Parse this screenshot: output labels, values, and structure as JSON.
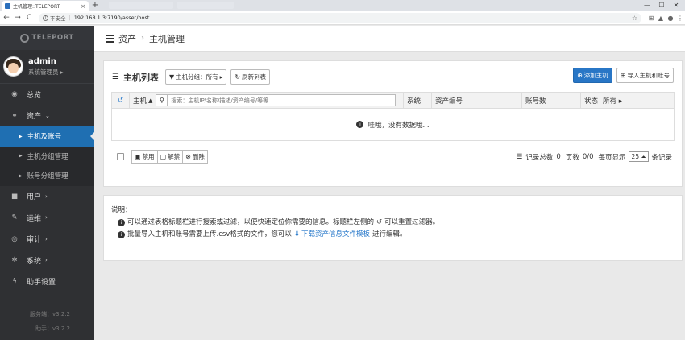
{
  "browser": {
    "tab_title": "主机管理::TELEPORT",
    "tab_close": "×",
    "new_tab": "+",
    "win_min": "—",
    "win_max": "☐",
    "win_close": "✕",
    "back": "←",
    "forward": "→",
    "reload": "C",
    "security": "不安全",
    "url": "192.168.1.3:7190/asset/host"
  },
  "sidebar": {
    "logo": "TELEPORT",
    "user": {
      "name": "admin",
      "role": "系统管理员"
    },
    "menu": [
      {
        "label": "总览",
        "icon": "dashboard-icon"
      },
      {
        "label": "资产",
        "icon": "sitemap-icon",
        "expanded": true
      },
      {
        "label": "主机及账号",
        "active": true
      },
      {
        "label": "主机分组管理"
      },
      {
        "label": "账号分组管理"
      },
      {
        "label": "用户",
        "icon": "user-icon"
      },
      {
        "label": "运维",
        "icon": "wrench-icon"
      },
      {
        "label": "审计",
        "icon": "eye-icon"
      },
      {
        "label": "系统",
        "icon": "gear-icon"
      },
      {
        "label": "助手设置",
        "icon": "bolt-icon"
      }
    ],
    "server_version": "服务端：v3.2.2",
    "assist_version": "助手：v3.2.2"
  },
  "breadcrumb": {
    "section": "资产",
    "page": "主机管理"
  },
  "list": {
    "title": "主机列表",
    "group_filter": "主机分组：所有",
    "refresh": "刷新列表",
    "add_host": "添加主机",
    "import": "导入主机和账号",
    "columns": {
      "host": "主机",
      "os": "系统",
      "asset_no": "资产编号",
      "accounts": "账号数",
      "status": "状态",
      "status_filter": "所有"
    },
    "search_placeholder": "搜索：主机IP/名称/描述/资产编号/等等...",
    "empty_text": "哇哦，没有数据哦...",
    "batch": {
      "disable": "禁用",
      "unlock": "解禁",
      "delete": "删除"
    },
    "pager": {
      "total_label": "记录总数",
      "total": "0",
      "page_label": "页数",
      "page": "0/0",
      "per_page_label": "每页显示",
      "per_page": "25",
      "per_page_suffix": "条记录"
    }
  },
  "notes": {
    "heading": "说明：",
    "line1": "可以通过表格标题栏进行搜索或过滤，以便快速定位你需要的信息。标题栏左侧的",
    "line1_end": "可以重置过滤器。",
    "line2": "批量导入主机和账号需要上传.csv格式的文件，您可以",
    "line2_link": "下载资产信息文件模板",
    "line2_end": "进行编辑。"
  }
}
